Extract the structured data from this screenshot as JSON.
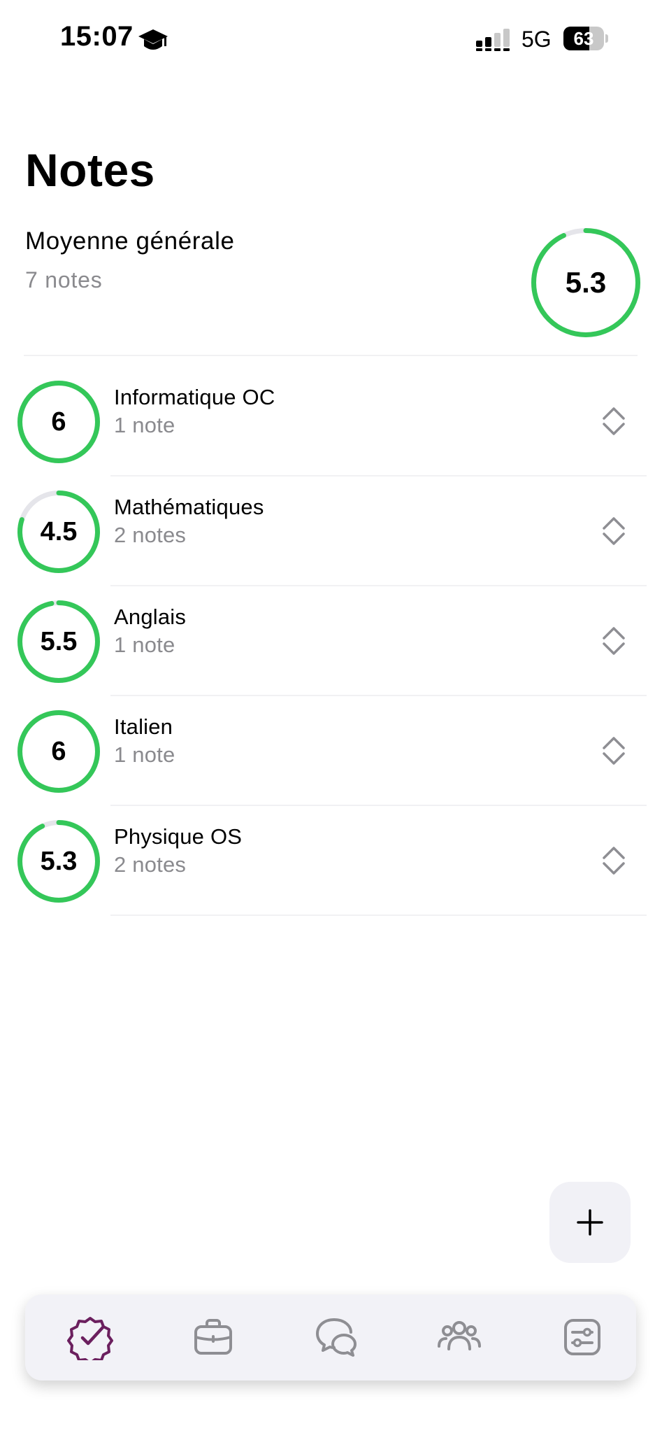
{
  "status_bar": {
    "time": "15:07",
    "network": "5G",
    "battery": "63",
    "battery_level": 0.63
  },
  "header": {
    "title": "Notes",
    "average_label": "Moyenne générale",
    "average_count": "7 notes",
    "average_value": "5.3",
    "average_ring_fraction": 0.93
  },
  "subjects": [
    {
      "name": "Informatique OC",
      "count": "1 note",
      "grade": "6",
      "ring_fraction": 1.0
    },
    {
      "name": "Mathématiques",
      "count": "2 notes",
      "grade": "4.5",
      "ring_fraction": 0.8
    },
    {
      "name": "Anglais",
      "count": "1 note",
      "grade": "5.5",
      "ring_fraction": 0.97
    },
    {
      "name": "Italien",
      "count": "1 note",
      "grade": "6",
      "ring_fraction": 1.0
    },
    {
      "name": "Physique OS",
      "count": "2 notes",
      "grade": "5.3",
      "ring_fraction": 0.93
    }
  ],
  "tabs": [
    {
      "id": "notes",
      "icon": "badge-check-icon",
      "active": true
    },
    {
      "id": "work",
      "icon": "briefcase-icon",
      "active": false
    },
    {
      "id": "messages",
      "icon": "chat-icon",
      "active": false
    },
    {
      "id": "people",
      "icon": "people-icon",
      "active": false
    },
    {
      "id": "settings",
      "icon": "sliders-icon",
      "active": false
    }
  ],
  "colors": {
    "ring_green": "#34c759",
    "ring_track": "#e5e5ea",
    "secondary_text": "#8a8a8e",
    "accent_purple": "#6b1f5e",
    "icon_gray": "#8e8e93"
  }
}
